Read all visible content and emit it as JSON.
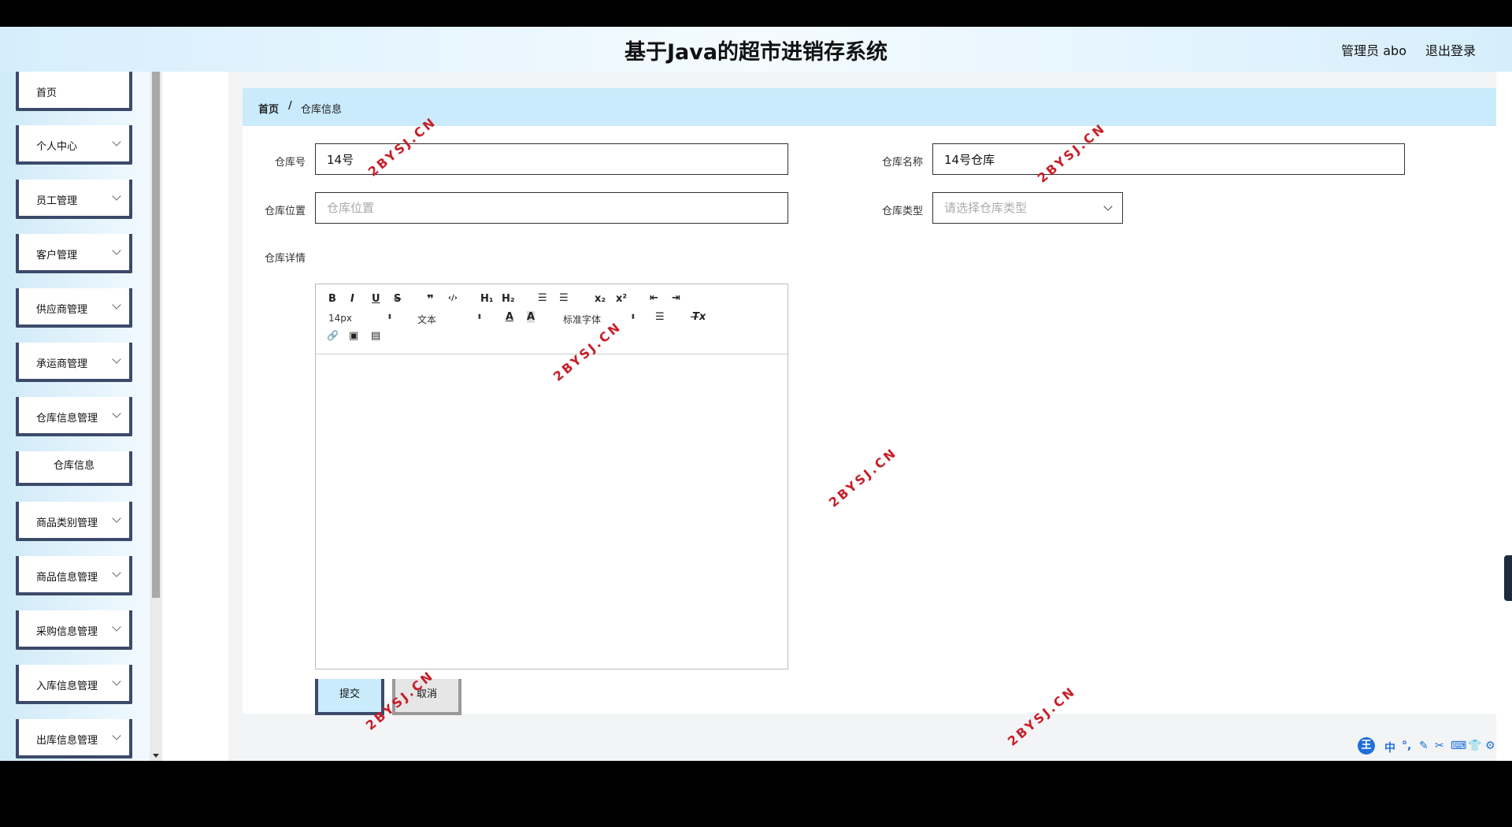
{
  "header": {
    "title": "基于Java的超市进销存系统",
    "user_label": "管理员 abo",
    "logout_label": "退出登录"
  },
  "sidebar": {
    "items": [
      {
        "label": "首页",
        "has_children": false
      },
      {
        "label": "个人中心",
        "has_children": true
      },
      {
        "label": "员工管理",
        "has_children": true
      },
      {
        "label": "客户管理",
        "has_children": true
      },
      {
        "label": "供应商管理",
        "has_children": true
      },
      {
        "label": "承运商管理",
        "has_children": true
      },
      {
        "label": "仓库信息管理",
        "has_children": true,
        "expanded": true
      },
      {
        "label": "商品类别管理",
        "has_children": true
      },
      {
        "label": "商品信息管理",
        "has_children": true
      },
      {
        "label": "采购信息管理",
        "has_children": true
      },
      {
        "label": "入库信息管理",
        "has_children": true
      },
      {
        "label": "出库信息管理",
        "has_children": true
      }
    ],
    "submenu": {
      "label": "仓库信息"
    }
  },
  "breadcrumb": {
    "home": "首页",
    "separator": "/",
    "current": "仓库信息"
  },
  "form": {
    "warehouse_no": {
      "label": "仓库号",
      "value": "14号"
    },
    "warehouse_name": {
      "label": "仓库名称",
      "value": "14号仓库"
    },
    "warehouse_location": {
      "label": "仓库位置",
      "value": "",
      "placeholder": "仓库位置"
    },
    "warehouse_type": {
      "label": "仓库类型",
      "value": "",
      "placeholder": "请选择仓库类型"
    },
    "warehouse_detail": {
      "label": "仓库详情",
      "value": ""
    }
  },
  "editor": {
    "toolbar": {
      "bold": "B",
      "italic": "I",
      "underline": "U",
      "strike": "S",
      "quote": "❞",
      "code": "‹/›",
      "h1": "H₁",
      "h2": "H₂",
      "ordered_list": "☰",
      "bullet_list": "☰",
      "subscript": "x₂",
      "superscript": "x²",
      "outdent": "⇤",
      "indent": "⇥",
      "size": "14px",
      "header_select": "文本",
      "font_select": "标准字体",
      "color": "A",
      "background": "A",
      "align": "☰",
      "clean": "T̶x",
      "link": "🔗",
      "image": "▣",
      "video": "▤"
    }
  },
  "buttons": {
    "submit": "提交",
    "cancel": "取消"
  },
  "watermark": {
    "text": "2BYSJ.CN"
  },
  "ime": {
    "items": [
      "王",
      "中",
      "°,",
      "✎",
      "✂",
      "⌨",
      "👕",
      "⚙"
    ]
  },
  "colors": {
    "accent_border": "#3c4a6a",
    "light_blue": "#c9ebfb",
    "watermark": "#c81e28"
  }
}
